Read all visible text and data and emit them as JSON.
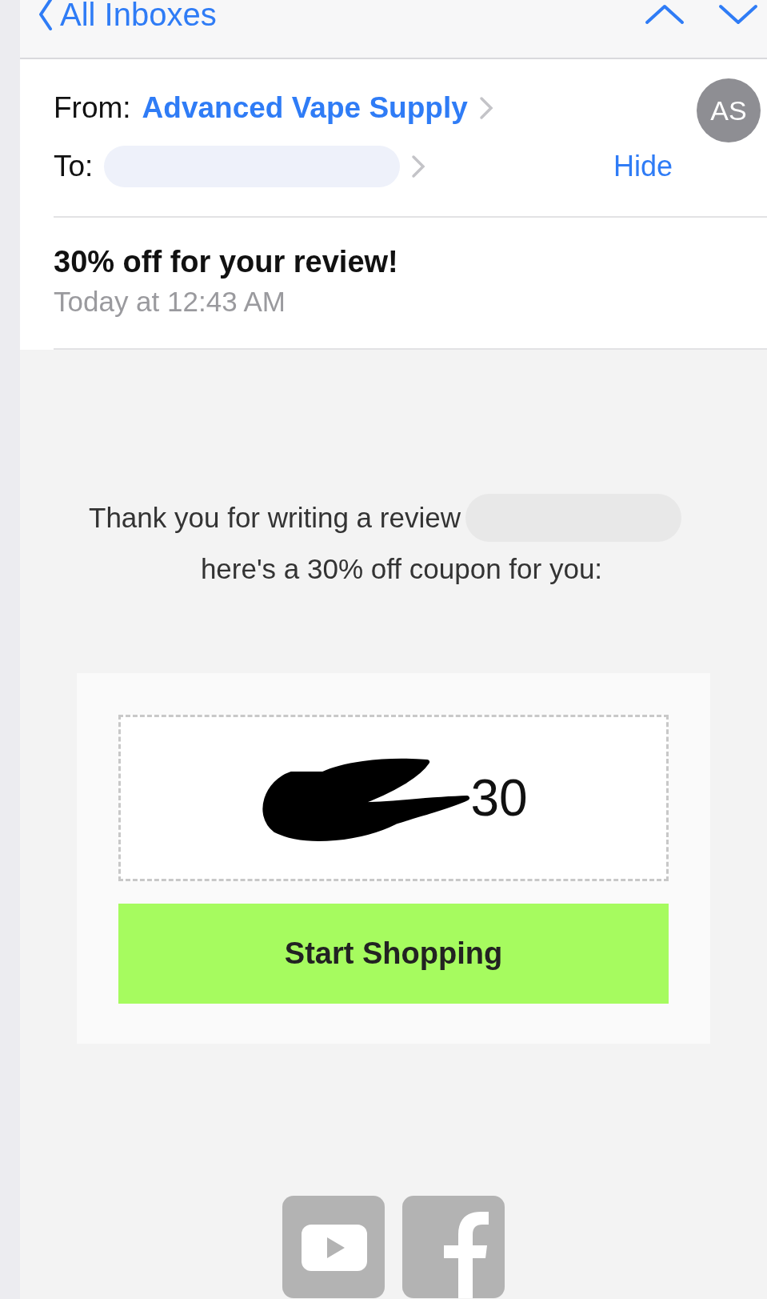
{
  "nav": {
    "back_label": "All Inboxes"
  },
  "header": {
    "from_label": "From:",
    "sender": "Advanced Vape Supply",
    "to_label": "To:",
    "hide_link": "Hide",
    "avatar_initials": "AS"
  },
  "message": {
    "subject": "30% off for your review!",
    "date": "Today at 12:43 AM"
  },
  "body": {
    "line_1": "Thank you for writing a review",
    "line_2": "here's a 30% off coupon for you:",
    "coupon_code_visible": "30",
    "button": "Start Shopping"
  },
  "social": [
    {
      "kind": "youtube"
    },
    {
      "kind": "facebook"
    }
  ]
}
